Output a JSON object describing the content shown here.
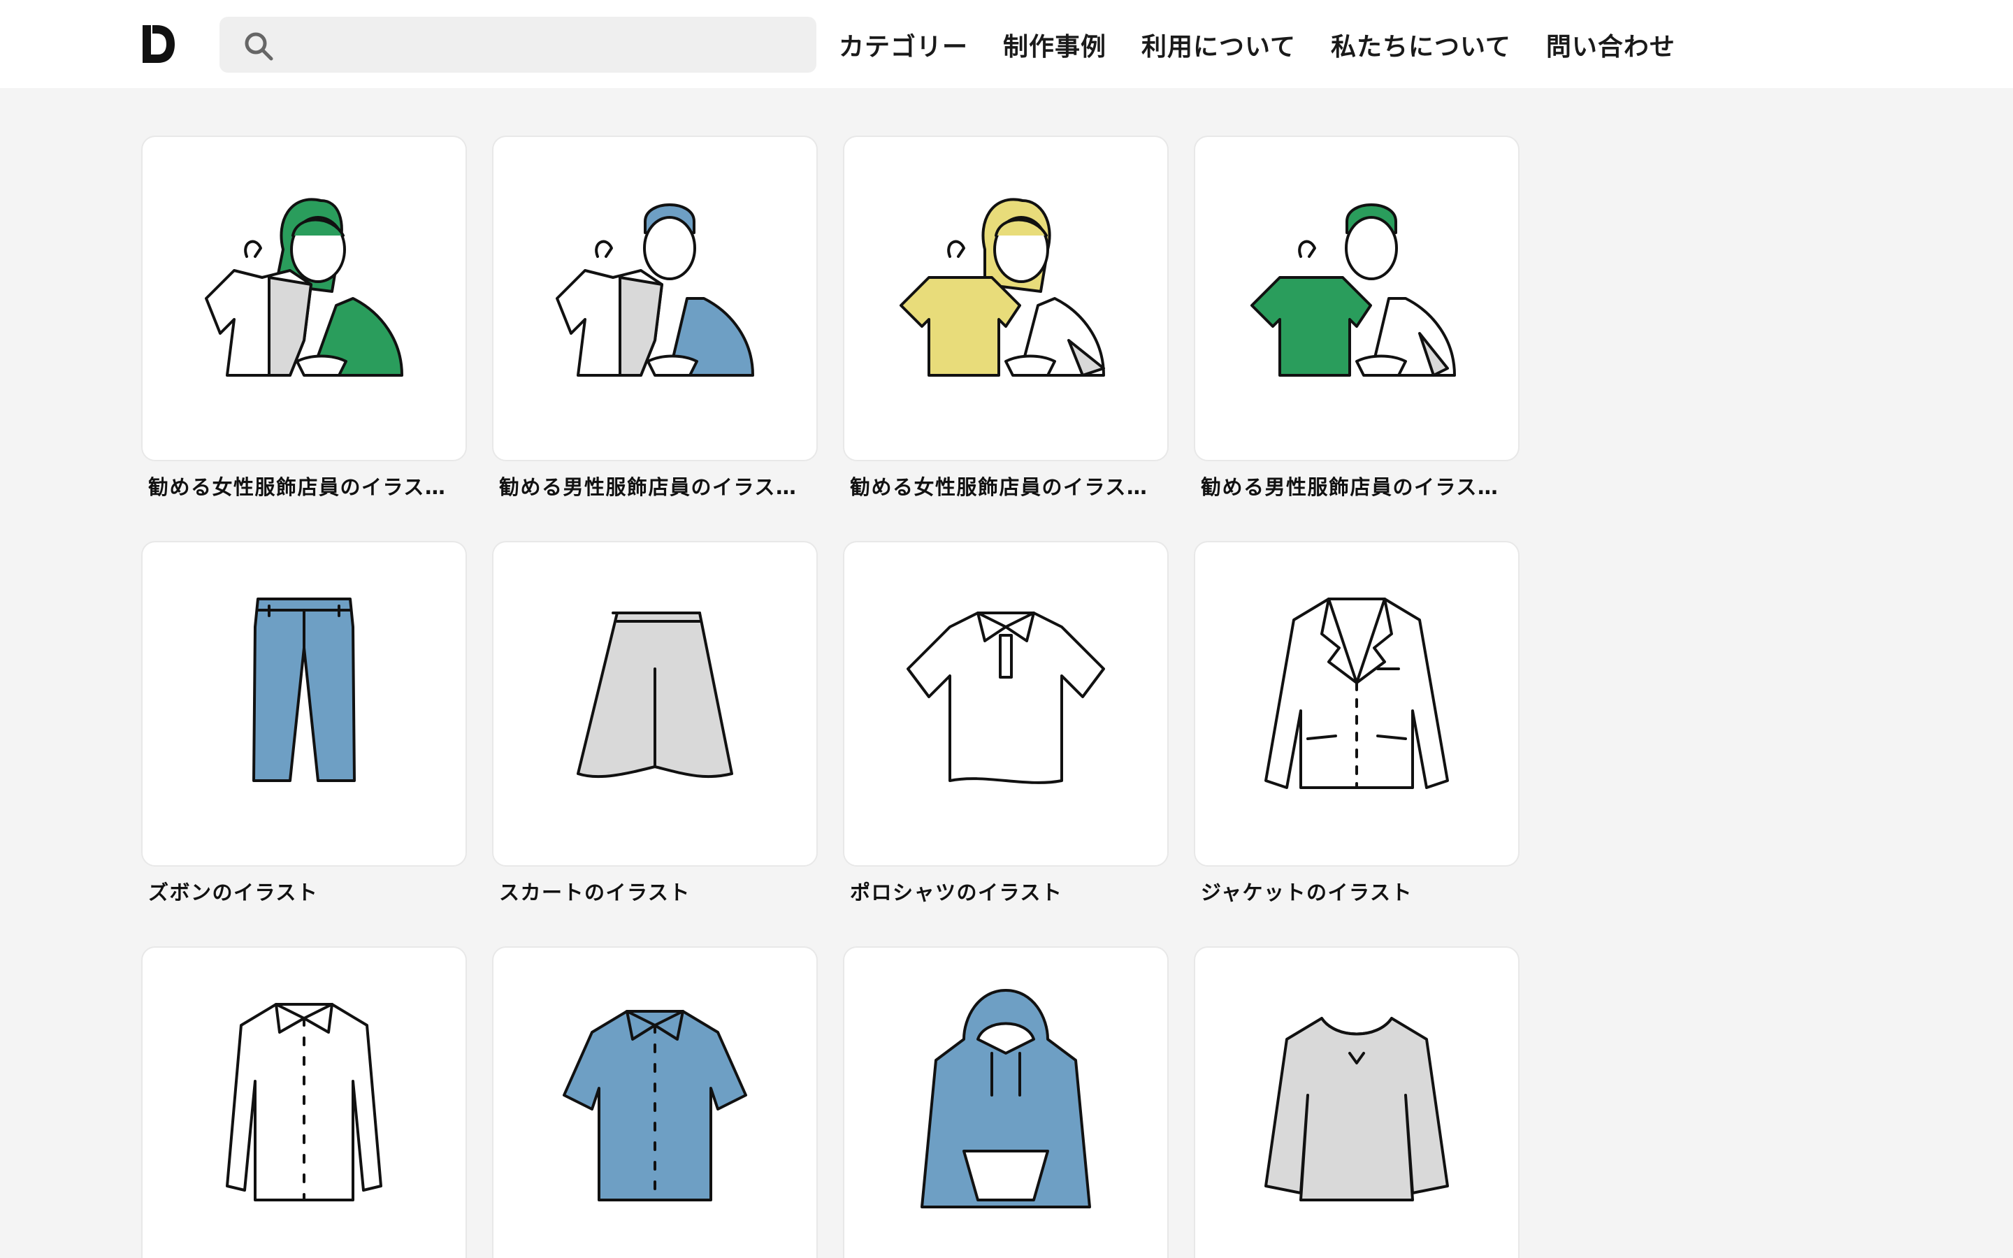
{
  "header": {
    "logo": "logo-d",
    "search": {
      "placeholder": "",
      "value": ""
    },
    "nav": [
      "カテゴリー",
      "制作事例",
      "利用について",
      "私たちについて",
      "問い合わせ"
    ]
  },
  "colors": {
    "green": "#2a9d5c",
    "blue": "#6e9fc4",
    "yellow": "#e8dc7a",
    "gray": "#d9d9d9",
    "line": "#111111"
  },
  "items": [
    {
      "caption": "勧める女性服飾店員のイラスト…",
      "icon": "woman-clerk-green-icon"
    },
    {
      "caption": "勧める男性服飾店員のイラスト…",
      "icon": "man-clerk-blue-icon"
    },
    {
      "caption": "勧める女性服飾店員のイラスト…",
      "icon": "woman-clerk-yellow-icon"
    },
    {
      "caption": "勧める男性服飾店員のイラスト…",
      "icon": "man-clerk-green-icon"
    },
    {
      "caption": "ズボンのイラスト",
      "icon": "pants-icon"
    },
    {
      "caption": "スカートのイラスト",
      "icon": "skirt-icon"
    },
    {
      "caption": "ポロシャツのイラスト",
      "icon": "polo-shirt-icon"
    },
    {
      "caption": "ジャケットのイラスト",
      "icon": "jacket-icon"
    },
    {
      "caption": "",
      "icon": "shirt-icon"
    },
    {
      "caption": "",
      "icon": "short-sleeve-shirt-icon"
    },
    {
      "caption": "",
      "icon": "hoodie-icon"
    },
    {
      "caption": "",
      "icon": "sweatshirt-icon"
    }
  ]
}
